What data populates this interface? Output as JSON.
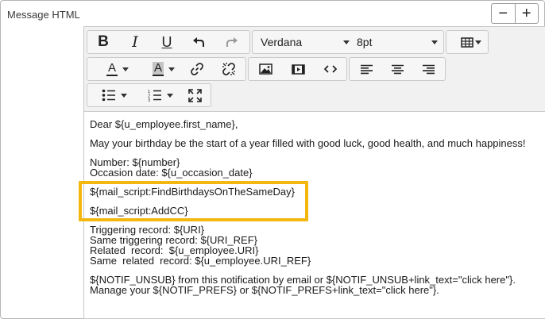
{
  "field": {
    "label": "Message HTML",
    "zoom_out": "−",
    "zoom_in": "+"
  },
  "toolbar": {
    "bold": "B",
    "italic": "I",
    "underline": "U",
    "font_family": "Verdana",
    "font_size": "8pt",
    "text_color": "A",
    "highlight_color": "A"
  },
  "content": {
    "lines": [
      "Dear ${u_employee.first_name},",
      "May your birthday be the start of a year filled with good luck, good health, and much happiness!",
      "Number: ${number}",
      "Occasion date: ${u_occasion_date}",
      "${mail_script:FindBirthdaysOnTheSameDay}",
      "${mail_script:AddCC}",
      "Triggering record: ${URI}",
      "Same triggering record: ${URI_REF}",
      "Related  record:  ${u_employee.URI}",
      "Same  related  record: ${u_employee.URI_REF}",
      "${NOTIF_UNSUB} from this notification by email or ${NOTIF_UNSUB+link_text=\"click here\"}.",
      "Manage your ${NOTIF_PREFS} or ${NOTIF_PREFS+link_text=\"click here\"}."
    ]
  },
  "colors": {
    "highlight_border": "#f3b70f",
    "toolbar_bg": "#f1f1f1"
  }
}
